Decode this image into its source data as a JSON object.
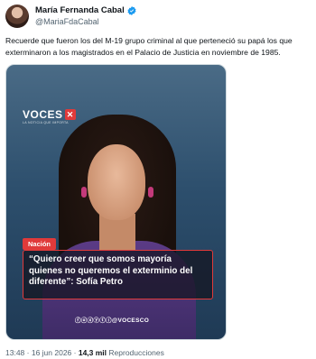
{
  "author": {
    "name": "María Fernanda Cabal",
    "handle": "@MariaFdaCabal",
    "verified_color": "#1d9bf0"
  },
  "tweet": {
    "text": "Recuerde que fueron los del M-19 grupo criminal al que perteneció su papá los que exterminaron a los magistrados en el Palacio de Justicia en noviembre de 1985."
  },
  "media": {
    "brand": "VOCES",
    "brand_mark": "✕",
    "brand_sub": "LA NOTICIA QUE IMPORTA",
    "category": "Nación",
    "headline": "“Quiero creer que somos mayoría quienes no queremos el exterminio del diferente”: Sofía Petro",
    "social_handle": "@VOCESCO",
    "social_icons": "ⓕⓞⓧⓨⓣⓘ"
  },
  "meta": {
    "time": "13:48",
    "separator": " · ",
    "date": "16 jun 2026",
    "views_count": "14,3 mil",
    "views_label": " Reproducciones"
  },
  "colors": {
    "accent_red": "#e03a3a",
    "text_primary": "#0f1419",
    "text_secondary": "#536471"
  }
}
